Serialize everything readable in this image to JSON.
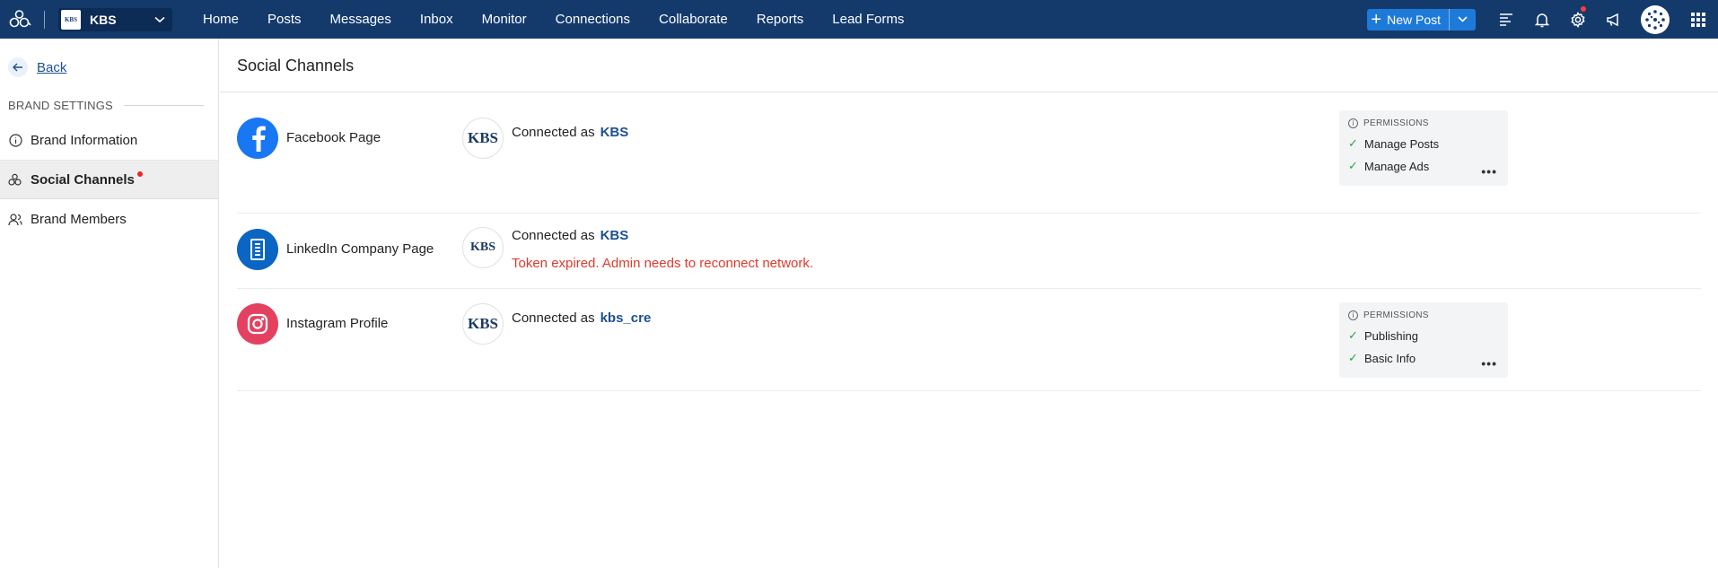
{
  "topbar": {
    "brand_name": "KBS",
    "brand_logo_text": "KBS",
    "nav": [
      "Home",
      "Posts",
      "Messages",
      "Inbox",
      "Monitor",
      "Connections",
      "Collaborate",
      "Reports",
      "Lead Forms"
    ],
    "new_post_label": "New Post",
    "background": "#143a6c",
    "accent": "#1e7ad8"
  },
  "sidebar": {
    "back_label": "Back",
    "section_title": "BRAND SETTINGS",
    "items": [
      {
        "label": "Brand Information",
        "icon": "info-icon",
        "active": false
      },
      {
        "label": "Social Channels",
        "icon": "channels-icon",
        "active": true
      },
      {
        "label": "Brand Members",
        "icon": "members-icon",
        "active": false
      }
    ]
  },
  "main": {
    "title": "Social Channels",
    "channels": [
      {
        "network": "Facebook Page",
        "icon": "facebook-icon",
        "color": "#1877f2",
        "account_logo": "KBS",
        "connected_prefix": "Connected as",
        "account": "KBS",
        "permissions_title": "PERMISSIONS",
        "permissions": [
          "Manage Posts",
          "Manage Ads"
        ]
      },
      {
        "network": "LinkedIn Company Page",
        "icon": "linkedin-company-icon",
        "color": "#0a66c2",
        "account_logo": "KBS",
        "connected_prefix": "Connected as",
        "account": "KBS",
        "error": "Token expired. Admin needs to reconnect network."
      },
      {
        "network": "Instagram Profile",
        "icon": "instagram-icon",
        "color": "#e4405f",
        "account_logo": "KBS",
        "connected_prefix": "Connected as",
        "account": "kbs_cre",
        "permissions_title": "PERMISSIONS",
        "permissions": [
          "Publishing",
          "Basic Info"
        ]
      }
    ]
  }
}
